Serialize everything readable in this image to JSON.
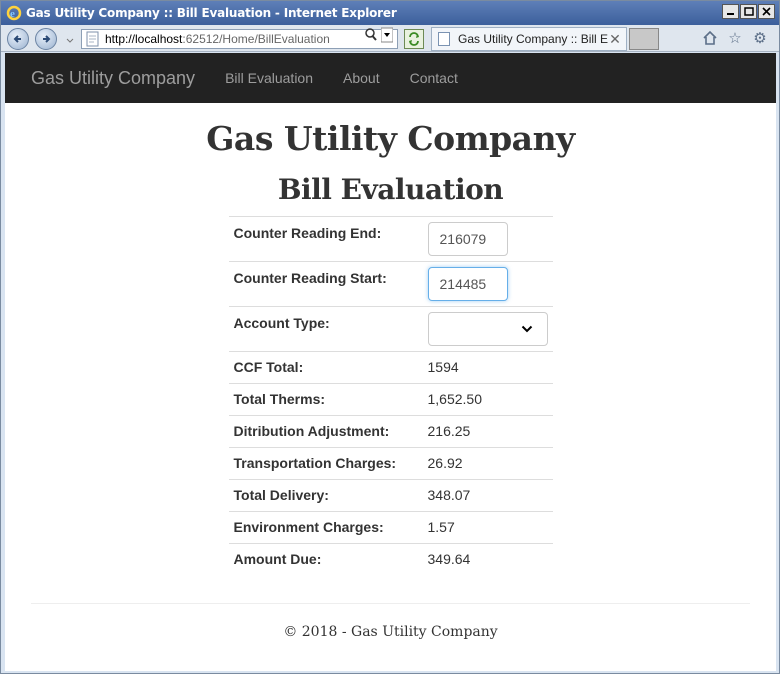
{
  "window": {
    "title": "Gas Utility Company :: Bill Evaluation - Internet Explorer",
    "address": {
      "host": "http://localhost",
      "rest": ":62512/Home/BillEvaluation"
    },
    "tab": {
      "label": "Gas Utility Company :: Bill Ev..."
    }
  },
  "site": {
    "brand": "Gas Utility Company",
    "nav": [
      "Bill Evaluation",
      "About",
      "Contact"
    ],
    "title": "Gas Utility Company",
    "subtitle": "Bill Evaluation",
    "footer": "© 2018 - Gas Utility Company"
  },
  "form": {
    "counter_end_label": "Counter Reading End:",
    "counter_end_value": "216079",
    "counter_start_label": "Counter Reading Start:",
    "counter_start_value": "214485",
    "account_type_label": "Account Type:",
    "account_type_value": ""
  },
  "results": [
    {
      "label": "CCF Total:",
      "value": "1594"
    },
    {
      "label": "Total Therms:",
      "value": "1,652.50"
    },
    {
      "label": "Ditribution Adjustment:",
      "value": "216.25"
    },
    {
      "label": "Transportation Charges:",
      "value": "26.92"
    },
    {
      "label": "Total Delivery:",
      "value": "348.07"
    },
    {
      "label": "Environment Charges:",
      "value": "1.57"
    },
    {
      "label": "Amount Due:",
      "value": "349.64"
    }
  ]
}
